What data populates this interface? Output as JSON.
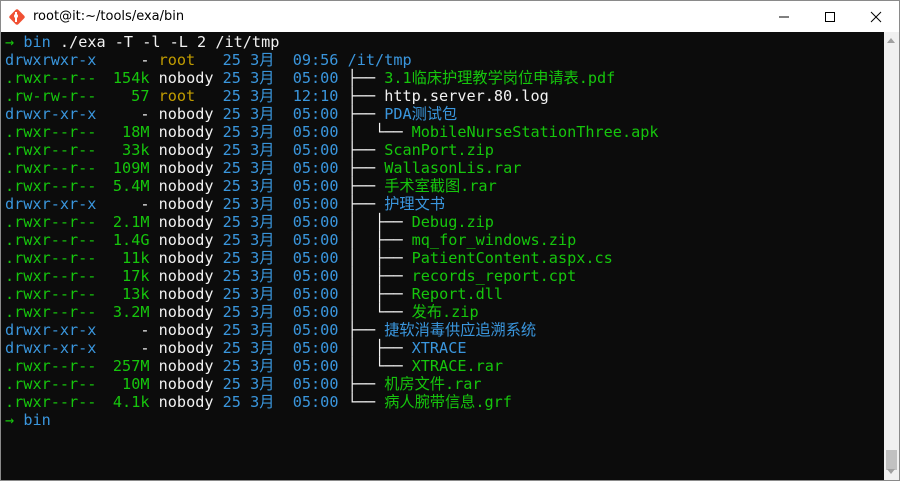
{
  "window": {
    "title": "root@it:~/tools/exa/bin"
  },
  "prompt": {
    "arrow": "→",
    "dir": "bin",
    "command": "./exa -T -l -L 2 /it/tmp"
  },
  "rows": [
    {
      "perm_a": "drwxrwxr-x",
      "perm_b": "",
      "size": "-",
      "user": "root",
      "day": "25",
      "month": "3月",
      "time": "09:56",
      "tree": "",
      "name": "/it/tmp"
    },
    {
      "perm_a": ".r",
      "perm_b": "wxr--r--",
      "size": "154k",
      "user": "nobody",
      "day": "25",
      "month": "3月",
      "time": "05:00",
      "tree": "├── ",
      "name": "3.1临床护理教学岗位申请表.pdf"
    },
    {
      "perm_a": ".rw-rw-r--",
      "perm_b": "",
      "size": "57",
      "user": "root",
      "day": "25",
      "month": "3月",
      "time": "12:10",
      "tree": "├── ",
      "name": "http.server.80.log"
    },
    {
      "perm_a": "drwxr-xr-x",
      "perm_b": "",
      "size": "-",
      "user": "nobody",
      "day": "25",
      "month": "3月",
      "time": "05:00",
      "tree": "├── ",
      "name": "PDA测试包"
    },
    {
      "perm_a": ".r",
      "perm_b": "wxr--r--",
      "size": "18M",
      "user": "nobody",
      "day": "25",
      "month": "3月",
      "time": "05:00",
      "tree": "│  └── ",
      "name": "MobileNurseStationThree.apk"
    },
    {
      "perm_a": ".r",
      "perm_b": "wxr--r--",
      "size": "33k",
      "user": "nobody",
      "day": "25",
      "month": "3月",
      "time": "05:00",
      "tree": "├── ",
      "name": "ScanPort.zip"
    },
    {
      "perm_a": ".r",
      "perm_b": "wxr--r--",
      "size": "109M",
      "user": "nobody",
      "day": "25",
      "month": "3月",
      "time": "05:00",
      "tree": "├── ",
      "name": "WallasonLis.rar"
    },
    {
      "perm_a": ".r",
      "perm_b": "wxr--r--",
      "size": "5.4M",
      "user": "nobody",
      "day": "25",
      "month": "3月",
      "time": "05:00",
      "tree": "├── ",
      "name": "手术室截图.rar"
    },
    {
      "perm_a": "drwxr-xr-x",
      "perm_b": "",
      "size": "-",
      "user": "nobody",
      "day": "25",
      "month": "3月",
      "time": "05:00",
      "tree": "├── ",
      "name": "护理文书"
    },
    {
      "perm_a": ".r",
      "perm_b": "wxr--r--",
      "size": "2.1M",
      "user": "nobody",
      "day": "25",
      "month": "3月",
      "time": "05:00",
      "tree": "│  ├── ",
      "name": "Debug.zip"
    },
    {
      "perm_a": ".r",
      "perm_b": "wxr--r--",
      "size": "1.4G",
      "user": "nobody",
      "day": "25",
      "month": "3月",
      "time": "05:00",
      "tree": "│  ├── ",
      "name": "mq_for_windows.zip"
    },
    {
      "perm_a": ".r",
      "perm_b": "wxr--r--",
      "size": "11k",
      "user": "nobody",
      "day": "25",
      "month": "3月",
      "time": "05:00",
      "tree": "│  ├── ",
      "name": "PatientContent.aspx.cs"
    },
    {
      "perm_a": ".r",
      "perm_b": "wxr--r--",
      "size": "17k",
      "user": "nobody",
      "day": "25",
      "month": "3月",
      "time": "05:00",
      "tree": "│  ├── ",
      "name": "records_report.cpt"
    },
    {
      "perm_a": ".r",
      "perm_b": "wxr--r--",
      "size": "13k",
      "user": "nobody",
      "day": "25",
      "month": "3月",
      "time": "05:00",
      "tree": "│  ├── ",
      "name": "Report.dll"
    },
    {
      "perm_a": ".r",
      "perm_b": "wxr--r--",
      "size": "3.2M",
      "user": "nobody",
      "day": "25",
      "month": "3月",
      "time": "05:00",
      "tree": "│  └── ",
      "name": "发布.zip"
    },
    {
      "perm_a": "drwxr-xr-x",
      "perm_b": "",
      "size": "-",
      "user": "nobody",
      "day": "25",
      "month": "3月",
      "time": "05:00",
      "tree": "├── ",
      "name": "捷软消毒供应追溯系统"
    },
    {
      "perm_a": "drwxr-xr-x",
      "perm_b": "",
      "size": "-",
      "user": "nobody",
      "day": "25",
      "month": "3月",
      "time": "05:00",
      "tree": "│  ├── ",
      "name": "XTRACE"
    },
    {
      "perm_a": ".r",
      "perm_b": "wxr--r--",
      "size": "257M",
      "user": "nobody",
      "day": "25",
      "month": "3月",
      "time": "05:00",
      "tree": "│  └── ",
      "name": "XTRACE.rar"
    },
    {
      "perm_a": ".r",
      "perm_b": "wxr--r--",
      "size": "10M",
      "user": "nobody",
      "day": "25",
      "month": "3月",
      "time": "05:00",
      "tree": "├── ",
      "name": "机房文件.rar"
    },
    {
      "perm_a": ".r",
      "perm_b": "wxr--r--",
      "size": "4.1k",
      "user": "nobody",
      "day": "25",
      "month": "3月",
      "time": "05:00",
      "tree": "└── ",
      "name": "病人腕带信息.grf"
    }
  ],
  "final_prompt": {
    "arrow": "→",
    "dir": "bin"
  },
  "colors": {
    "background": "#0c0c0c",
    "green": "#13a10e",
    "yellow": "#c19c00",
    "blue": "#3a96dd",
    "white": "#f2f2f2"
  }
}
